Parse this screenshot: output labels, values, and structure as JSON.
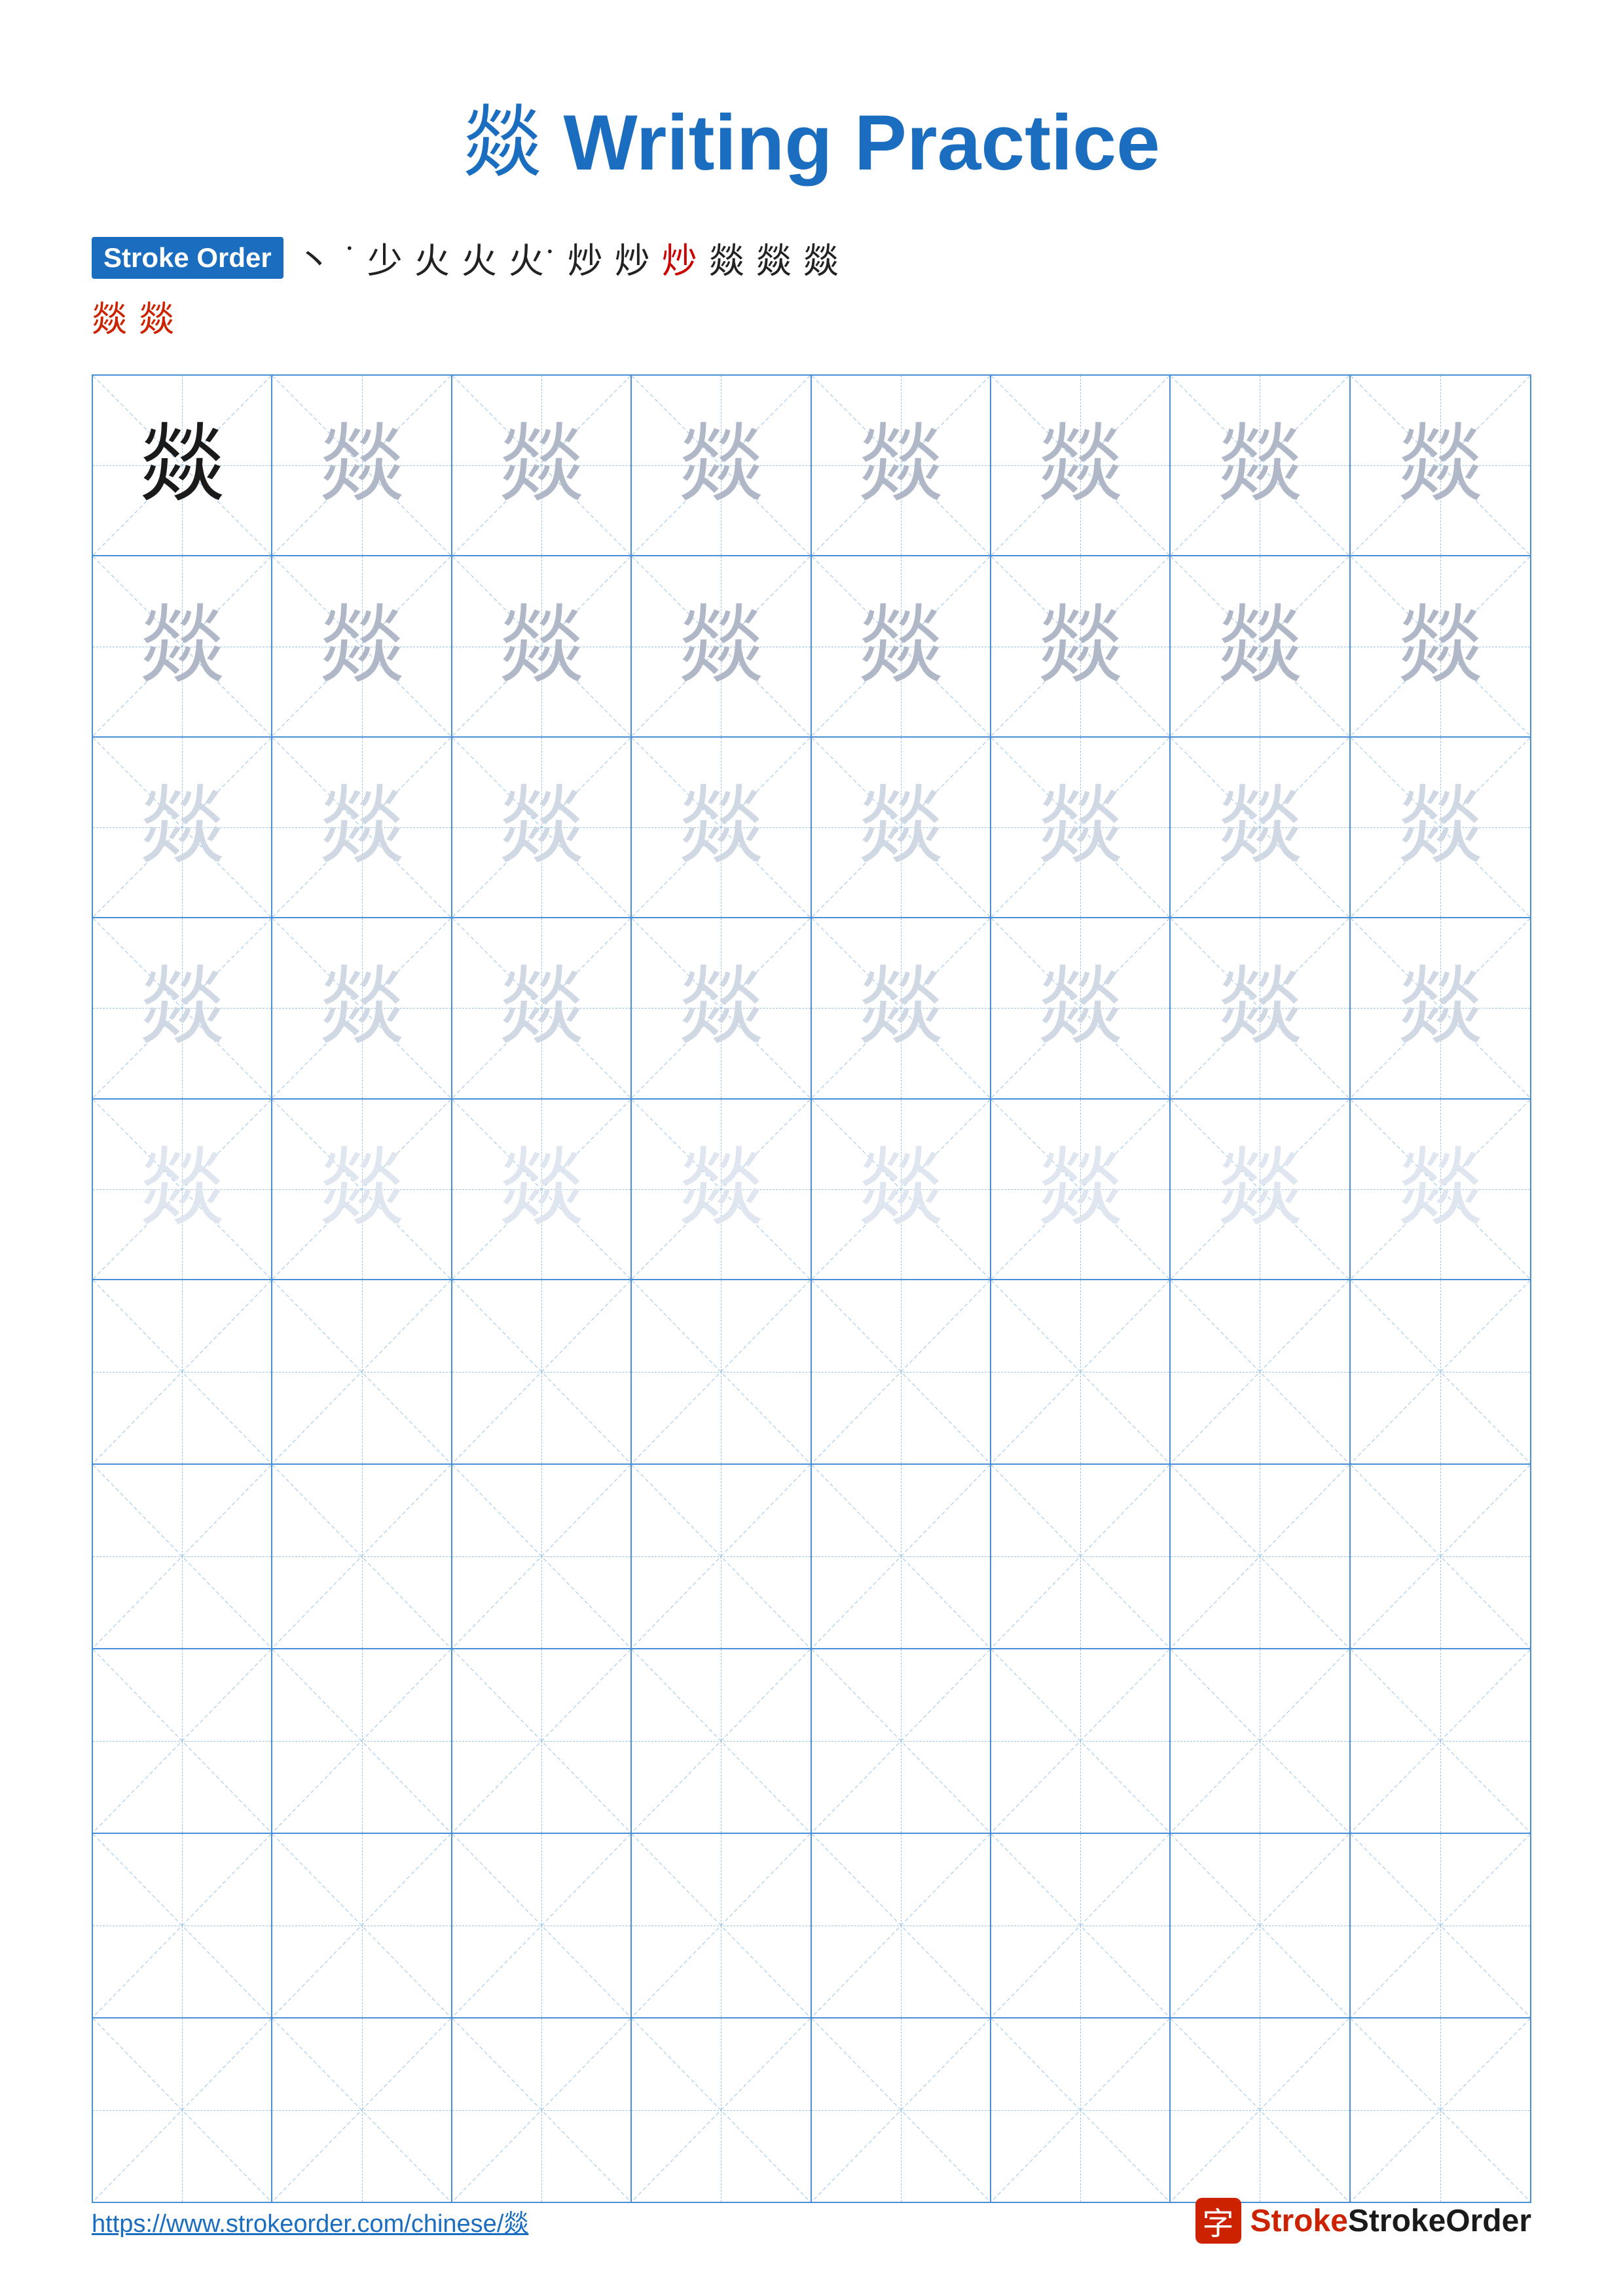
{
  "title": {
    "char": "燚",
    "text": " Writing Practice"
  },
  "stroke_order": {
    "badge_label": "Stroke Order",
    "chars_row1": [
      "丶",
      "灬",
      "少",
      "火",
      "火",
      "火˙",
      "炒",
      "炒",
      "炒",
      "燚",
      "燚",
      "燚"
    ],
    "chars_row2": [
      "燚",
      "燚"
    ]
  },
  "grid": {
    "rows": 10,
    "cols": 8,
    "char": "燚",
    "filled_rows": 5,
    "shading_pattern": [
      [
        "dark",
        "medium",
        "medium",
        "medium",
        "medium",
        "medium",
        "medium",
        "medium"
      ],
      [
        "medium",
        "medium",
        "medium",
        "medium",
        "medium",
        "medium",
        "medium",
        "medium"
      ],
      [
        "light",
        "light",
        "light",
        "light",
        "light",
        "light",
        "light",
        "light"
      ],
      [
        "light",
        "light",
        "light",
        "light",
        "light",
        "light",
        "light",
        "light"
      ],
      [
        "very-light",
        "very-light",
        "very-light",
        "very-light",
        "very-light",
        "very-light",
        "very-light",
        "very-light"
      ]
    ]
  },
  "footer": {
    "url": "https://www.strokeorder.com/chinese/燚",
    "logo_char": "字",
    "logo_text": "StrokeOrder"
  }
}
